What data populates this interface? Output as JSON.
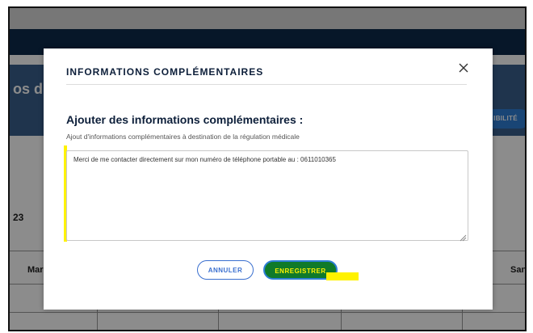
{
  "background": {
    "banner_title": "os d",
    "availability_label": "IBILITÉ",
    "section_label": "23",
    "calendar_left": "Mar",
    "calendar_right": "San"
  },
  "modal": {
    "title": "INFORMATIONS COMPLÉMENTAIRES",
    "close_icon": "close-icon",
    "heading": "Ajouter des informations complémentaires :",
    "subheading": "Ajout d'informations complémentaires à destination de la régulation médicale",
    "textarea_value": "Merci de me contacter directement sur mon numéro de téléphone portable au : 0611010365",
    "cancel_label": "ANNULER",
    "save_label": "ENREGISTRER"
  },
  "colors": {
    "navbar": "#0d2a4c",
    "banner": "#3a5f8d",
    "accent_blue": "#2f7fd6",
    "highlight_yellow": "#fff200",
    "save_green": "#0f7a2a"
  }
}
